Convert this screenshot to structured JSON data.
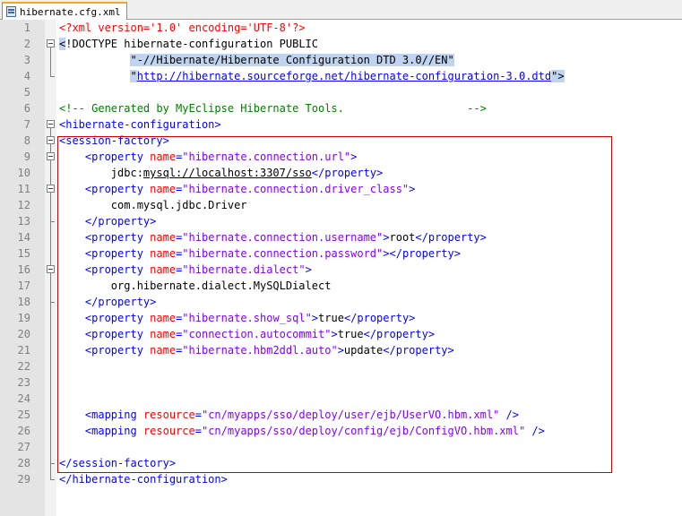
{
  "tab": {
    "label": "hibernate.cfg.xml",
    "icon": "file-icon"
  },
  "lines": [
    {
      "n": "1",
      "t": [
        [
          "pi",
          "<?xml version='1.0' encoding='UTF-8'?>"
        ]
      ]
    },
    {
      "n": "2",
      "t": [
        [
          "sel",
          "<"
        ],
        [
          "doc",
          "!DOCTYPE hibernate-configuration PUBLIC"
        ]
      ]
    },
    {
      "n": "3",
      "t": [
        [
          "doc",
          "           "
        ],
        [
          "sel",
          "\"-//Hibernate/Hibernate Configuration DTD 3.0//EN\""
        ]
      ]
    },
    {
      "n": "4",
      "t": [
        [
          "doc",
          "           "
        ],
        [
          "sel",
          "\""
        ],
        [
          "url",
          "http://hibernate.sourceforge.net/hibernate-configuration-3.0.dtd"
        ],
        [
          "sel",
          "\">"
        ]
      ]
    },
    {
      "n": "5",
      "t": []
    },
    {
      "n": "6",
      "t": [
        [
          "com",
          "<!-- Generated by MyEclipse Hibernate Tools.                   -->"
        ]
      ]
    },
    {
      "n": "7",
      "t": [
        [
          "tag",
          "<hibernate-configuration>"
        ]
      ]
    },
    {
      "n": "8",
      "t": [
        [
          "tag",
          "<session-factory>"
        ]
      ]
    },
    {
      "n": "9",
      "t": [
        [
          "txt",
          "    "
        ],
        [
          "tag",
          "<property "
        ],
        [
          "attr",
          "name"
        ],
        [
          "tag",
          "="
        ],
        [
          "val",
          "\"hibernate.connection.url\""
        ],
        [
          "tag",
          ">"
        ]
      ]
    },
    {
      "n": "10",
      "t": [
        [
          "txt",
          "        jdbc:"
        ],
        [
          "ul",
          "mysql://localhost:3307/sso"
        ],
        [
          "tag",
          "</property>"
        ]
      ]
    },
    {
      "n": "11",
      "t": [
        [
          "txt",
          "    "
        ],
        [
          "tag",
          "<property "
        ],
        [
          "attr",
          "name"
        ],
        [
          "tag",
          "="
        ],
        [
          "val",
          "\"hibernate.connection.driver_class\""
        ],
        [
          "tag",
          ">"
        ]
      ]
    },
    {
      "n": "12",
      "t": [
        [
          "txt",
          "        com.mysql.jdbc.Driver"
        ]
      ]
    },
    {
      "n": "13",
      "t": [
        [
          "txt",
          "    "
        ],
        [
          "tag",
          "</property>"
        ]
      ]
    },
    {
      "n": "14",
      "t": [
        [
          "txt",
          "    "
        ],
        [
          "tag",
          "<property "
        ],
        [
          "attr",
          "name"
        ],
        [
          "tag",
          "="
        ],
        [
          "val",
          "\"hibernate.connection.username\""
        ],
        [
          "tag",
          ">"
        ],
        [
          "txt",
          "root"
        ],
        [
          "tag",
          "</property>"
        ]
      ]
    },
    {
      "n": "15",
      "t": [
        [
          "txt",
          "    "
        ],
        [
          "tag",
          "<property "
        ],
        [
          "attr",
          "name"
        ],
        [
          "tag",
          "="
        ],
        [
          "val",
          "\"hibernate.connection.password\""
        ],
        [
          "tag",
          "></property>"
        ]
      ]
    },
    {
      "n": "16",
      "t": [
        [
          "txt",
          "    "
        ],
        [
          "tag",
          "<property "
        ],
        [
          "attr",
          "name"
        ],
        [
          "tag",
          "="
        ],
        [
          "val",
          "\"hibernate.dialect\""
        ],
        [
          "tag",
          ">"
        ]
      ]
    },
    {
      "n": "17",
      "t": [
        [
          "txt",
          "        org.hibernate.dialect.MySQLDialect"
        ]
      ]
    },
    {
      "n": "18",
      "t": [
        [
          "txt",
          "    "
        ],
        [
          "tag",
          "</property>"
        ]
      ]
    },
    {
      "n": "19",
      "t": [
        [
          "txt",
          "    "
        ],
        [
          "tag",
          "<property "
        ],
        [
          "attr",
          "name"
        ],
        [
          "tag",
          "="
        ],
        [
          "val",
          "\"hibernate.show_sql\""
        ],
        [
          "tag",
          ">"
        ],
        [
          "txt",
          "true"
        ],
        [
          "tag",
          "</property>"
        ]
      ]
    },
    {
      "n": "20",
      "t": [
        [
          "txt",
          "    "
        ],
        [
          "tag",
          "<property "
        ],
        [
          "attr",
          "name"
        ],
        [
          "tag",
          "="
        ],
        [
          "val",
          "\"connection.autocommit\""
        ],
        [
          "tag",
          ">"
        ],
        [
          "txt",
          "true"
        ],
        [
          "tag",
          "</property>"
        ]
      ]
    },
    {
      "n": "21",
      "t": [
        [
          "txt",
          "    "
        ],
        [
          "tag",
          "<property "
        ],
        [
          "attr",
          "name"
        ],
        [
          "tag",
          "="
        ],
        [
          "val",
          "\"hibernate.hbm2ddl.auto\""
        ],
        [
          "tag",
          ">"
        ],
        [
          "txt",
          "update"
        ],
        [
          "tag",
          "</property>"
        ]
      ]
    },
    {
      "n": "22",
      "t": []
    },
    {
      "n": "23",
      "t": []
    },
    {
      "n": "24",
      "t": []
    },
    {
      "n": "25",
      "t": [
        [
          "txt",
          "    "
        ],
        [
          "tag",
          "<mapping "
        ],
        [
          "attr",
          "resource"
        ],
        [
          "tag",
          "="
        ],
        [
          "val",
          "\"cn/myapps/sso/deploy/user/ejb/UserVO.hbm.xml\""
        ],
        [
          "tag",
          " />"
        ]
      ]
    },
    {
      "n": "26",
      "t": [
        [
          "txt",
          "    "
        ],
        [
          "tag",
          "<mapping "
        ],
        [
          "attr",
          "resource"
        ],
        [
          "tag",
          "="
        ],
        [
          "val",
          "\"cn/myapps/sso/deploy/config/ejb/ConfigVO.hbm.xml\""
        ],
        [
          "tag",
          " />"
        ]
      ]
    },
    {
      "n": "27",
      "t": []
    },
    {
      "n": "28",
      "t": [
        [
          "tag",
          "</session-factory>"
        ]
      ]
    },
    {
      "n": "29",
      "t": [
        [
          "tag",
          "</hibernate-configuration>"
        ]
      ]
    }
  ],
  "colors": {
    "highlight_box": "#d00000",
    "tab_accent": "#f5a623"
  }
}
